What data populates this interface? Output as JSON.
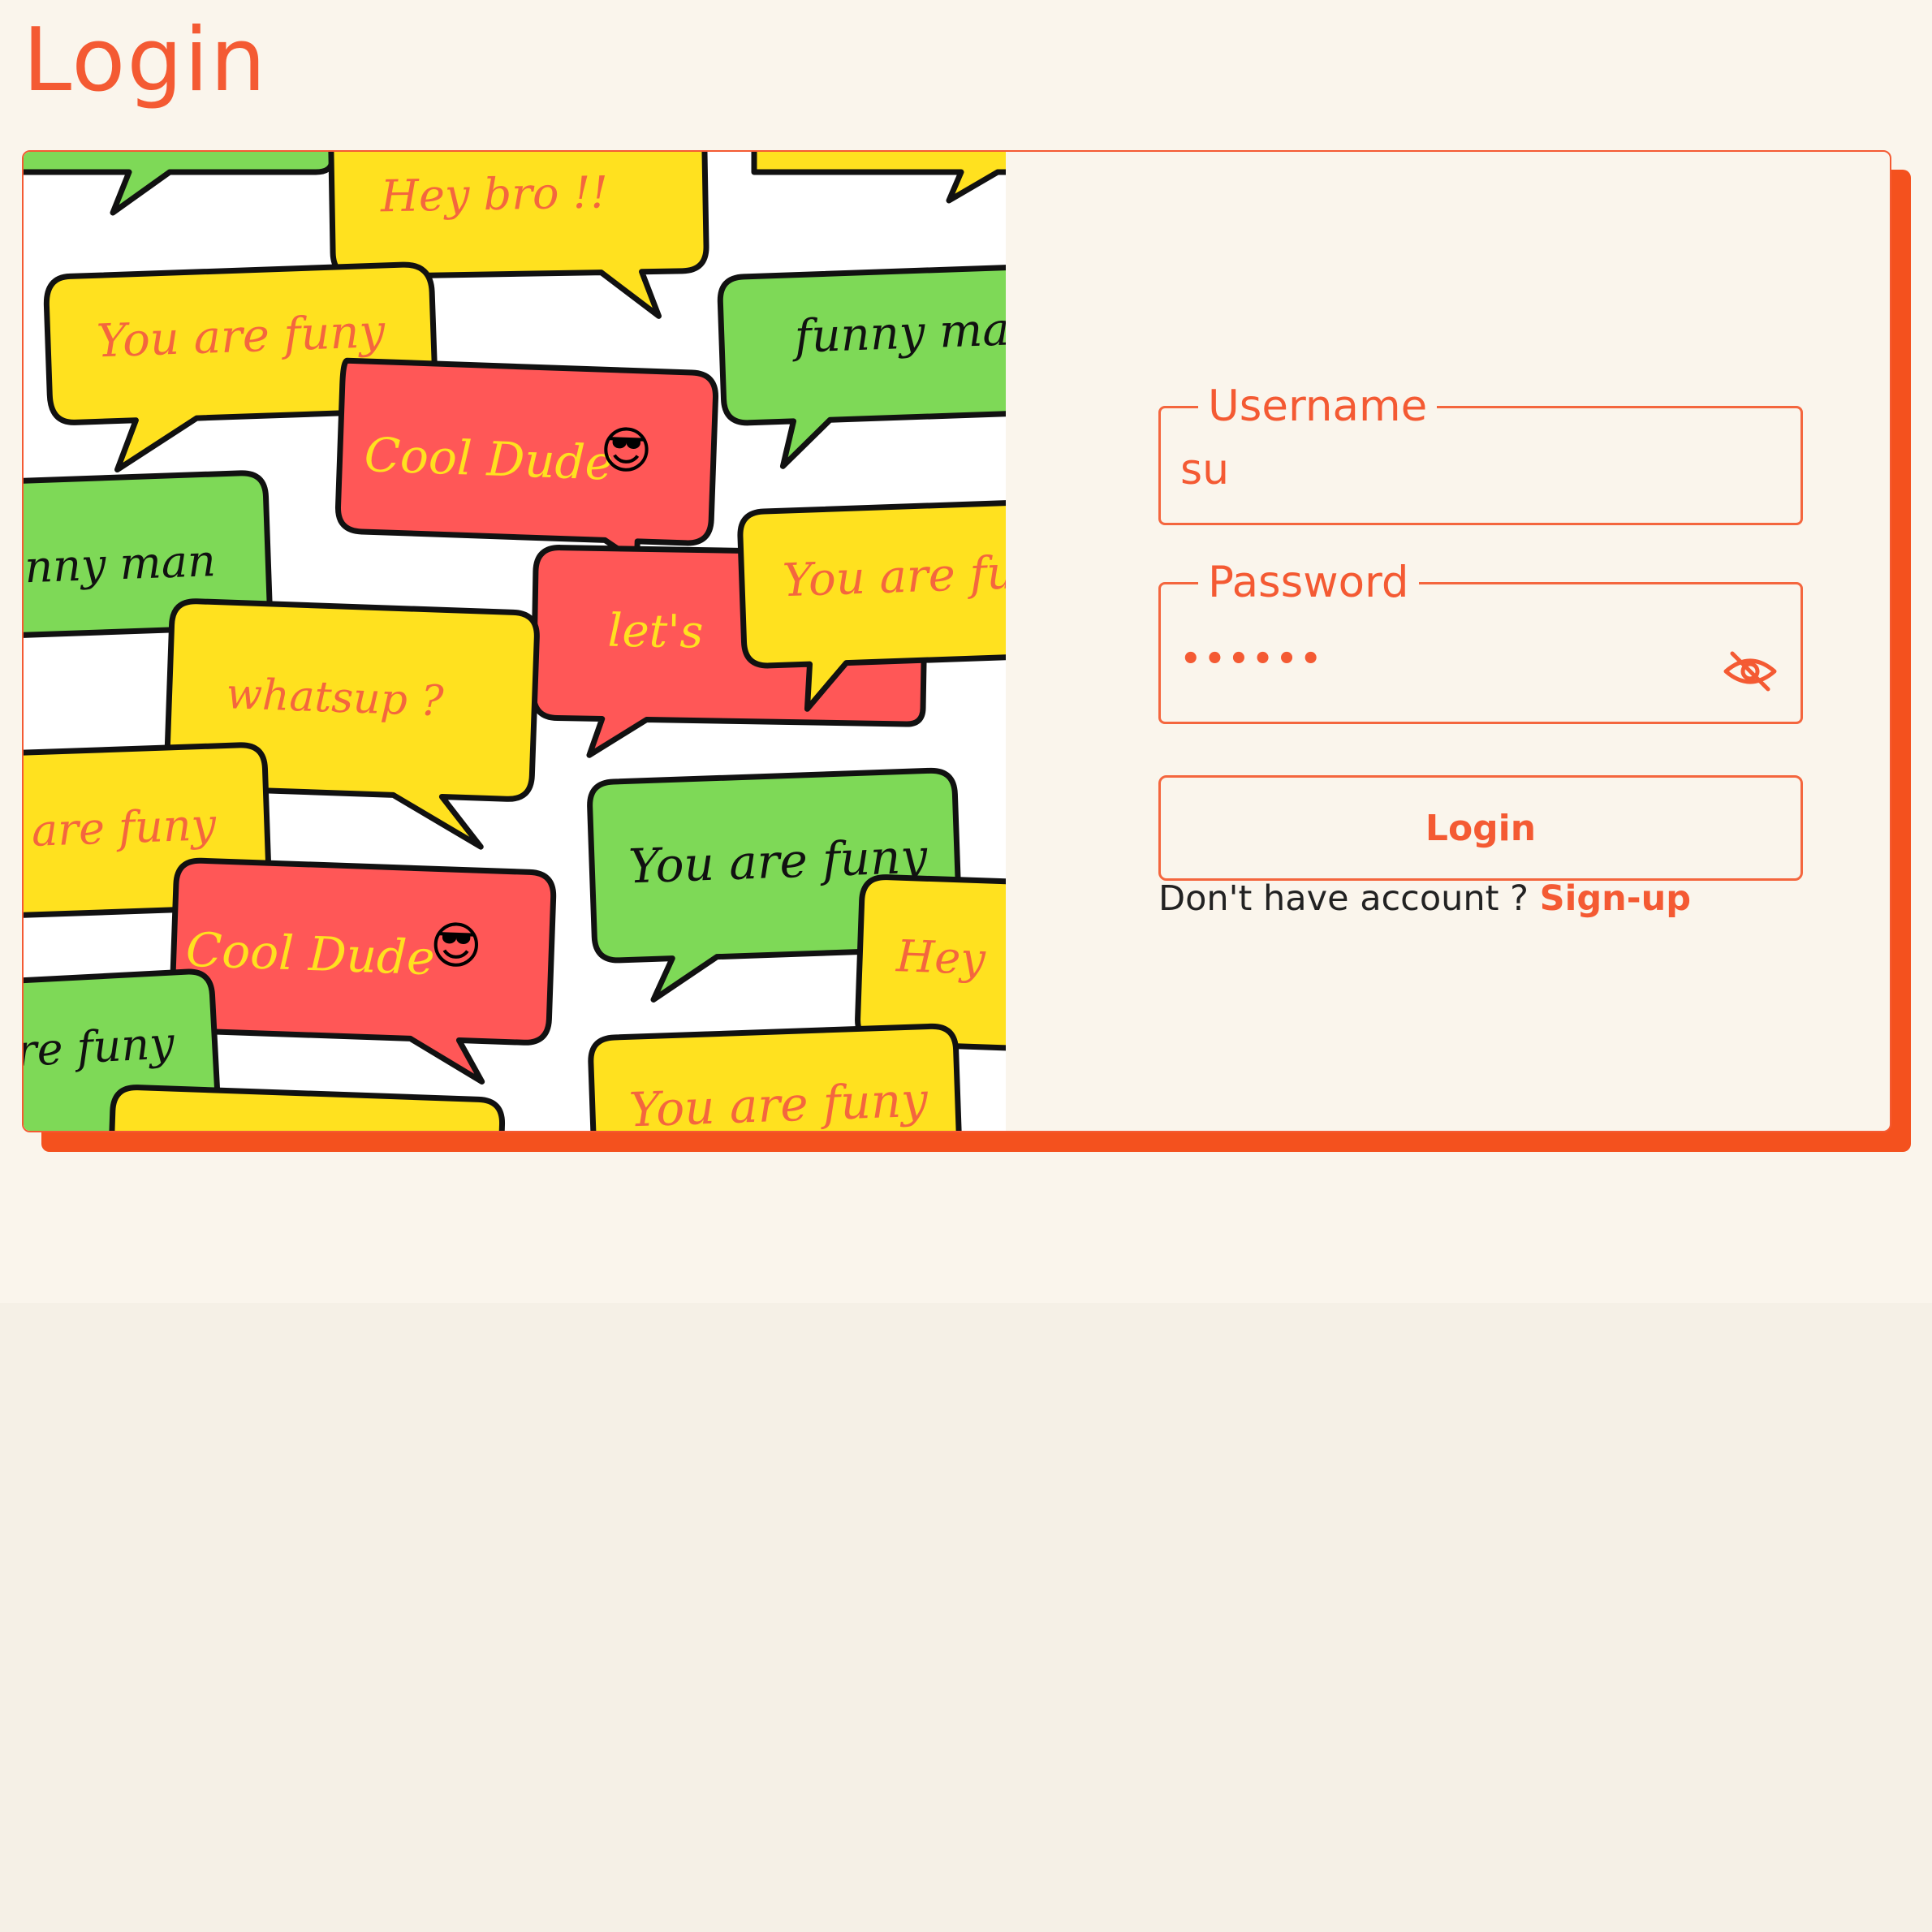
{
  "page": {
    "title": "Login"
  },
  "illustration": {
    "bubbles": [
      "Hey bro !!",
      "You are funy",
      "funny man",
      "Cool Dude",
      "nny man",
      "let's",
      "You are fu",
      "whatsup ?",
      "are funy",
      "You are funy",
      "Cool Dude",
      "Hey",
      "re funy",
      "You are funy"
    ],
    "emoji": "😎"
  },
  "form": {
    "username": {
      "label": "Username",
      "value": "su"
    },
    "password": {
      "label": "Password",
      "value": "••••••",
      "toggle_icon": "eye-off-icon"
    },
    "login_button": "Login",
    "signup_prompt": "Don't have account ?",
    "signup_link": "Sign-up"
  },
  "colors": {
    "accent": "#f45a33",
    "shadow": "#f4511e",
    "background": "#faf5ec",
    "bubble_yellow": "#ffe11f",
    "bubble_green": "#7ed957",
    "bubble_red": "#ff5757"
  }
}
